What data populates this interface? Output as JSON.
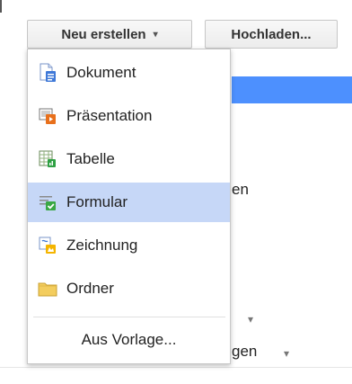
{
  "toolbar": {
    "new_label": "Neu erstellen",
    "new_caret": "▾",
    "upload_label": "Hochladen..."
  },
  "menu": {
    "items": [
      {
        "label": "Dokument",
        "icon": "document-icon"
      },
      {
        "label": "Präsentation",
        "icon": "presentation-icon"
      },
      {
        "label": "Tabelle",
        "icon": "spreadsheet-icon"
      },
      {
        "label": "Formular",
        "icon": "form-icon",
        "selected": true
      },
      {
        "label": "Zeichnung",
        "icon": "drawing-icon"
      },
      {
        "label": "Ordner",
        "icon": "folder-icon"
      }
    ],
    "template_label": "Aus Vorlage..."
  },
  "background": {
    "partial_text_1": "en",
    "partial_text_2": "gen",
    "caret": "▾"
  },
  "colors": {
    "selected_bg": "#c6d7f7",
    "accent_bar": "#4d90fe"
  }
}
